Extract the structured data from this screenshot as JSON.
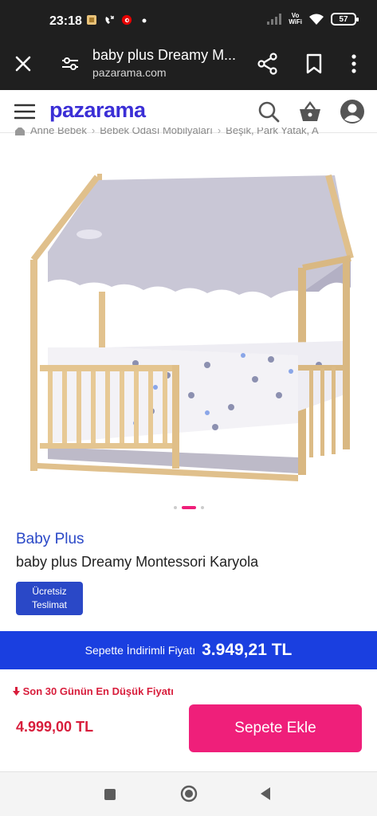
{
  "status_bar": {
    "time": "23:18",
    "vo_wifi_line1": "Vo",
    "vo_wifi_line2": "WiFi",
    "battery": "57",
    "icons": [
      "notification-icon",
      "missed-call-icon",
      "vodafone-icon",
      "dot-icon",
      "signal-icon",
      "wifi-icon",
      "battery-icon"
    ]
  },
  "browser": {
    "page_title": "baby plus Dreamy M...",
    "domain": "pazarama.com",
    "icons": [
      "close-icon",
      "tune-icon",
      "share-icon",
      "bookmark-icon",
      "more-vert-icon"
    ]
  },
  "header": {
    "logo": "pazarama",
    "icons": [
      "menu-icon",
      "search-icon",
      "cart-icon",
      "account-icon"
    ],
    "accent_color": "#3b2fd6"
  },
  "breadcrumb": {
    "items": [
      "Anne Bebek",
      "Bebek Odası Mobilyaları",
      "Beşik, Park Yatak, A"
    ]
  },
  "gallery": {
    "image_alt": "Montessori house bed with grey canopy",
    "slide_count": 3,
    "active_slide": 2
  },
  "product": {
    "brand": "Baby Plus",
    "name": "baby plus Dreamy Montessori Karyola",
    "badge_line1": "Ücretsiz",
    "badge_line2": "Teslimat"
  },
  "pricing": {
    "cart_price_label": "Sepette İndirimli Fiyatı",
    "cart_price": "3.949,21 TL",
    "lowest_label": "Son 30 Günün En Düşük Fiyatı",
    "old_price": "4.999,00 TL",
    "add_to_cart": "Sepete Ekle",
    "banner_color": "#1a3fe0",
    "button_color": "#ef1f7a",
    "price_color": "#d81e3c"
  },
  "nav": {
    "icons": [
      "recents-icon",
      "home-icon",
      "back-icon"
    ]
  }
}
